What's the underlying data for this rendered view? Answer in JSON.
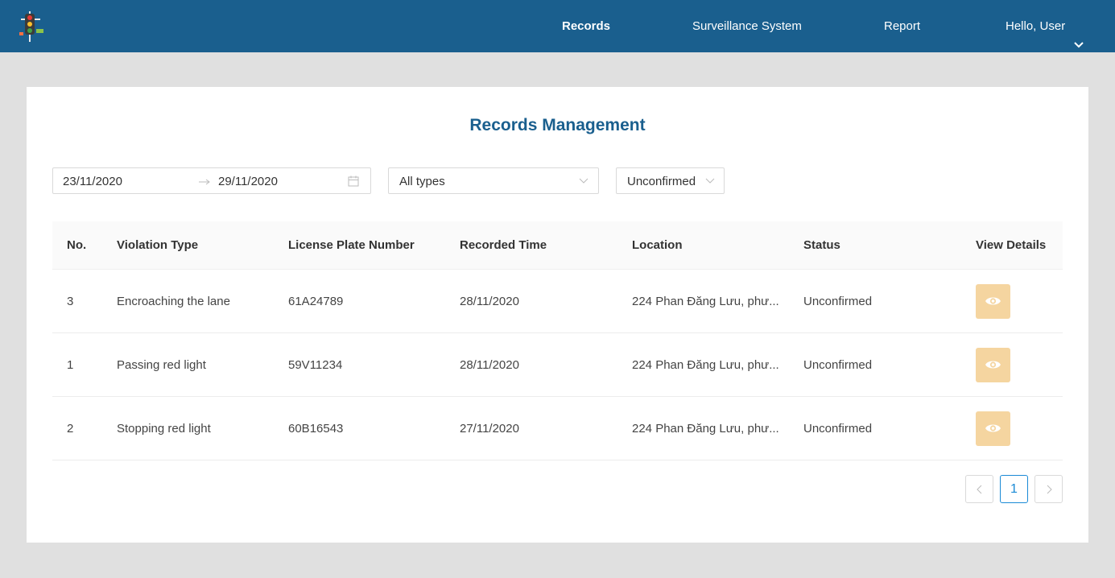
{
  "nav": {
    "items": [
      {
        "label": "Records",
        "active": true
      },
      {
        "label": "Surveillance System",
        "active": false
      },
      {
        "label": "Report",
        "active": false
      }
    ],
    "user_label": "Hello, User",
    "logo_icon": "traffic-light-icon"
  },
  "page": {
    "title": "Records Management"
  },
  "filters": {
    "date_start": "23/11/2020",
    "date_end": "29/11/2020",
    "type_value": "All types",
    "status_value": "Unconfirmed"
  },
  "table": {
    "columns": [
      "No.",
      "Violation Type",
      "License Plate Number",
      "Recorded Time",
      "Location",
      "Status",
      "View Details"
    ],
    "rows": [
      {
        "no": "3",
        "type": "Encroaching the lane",
        "plate": "61A24789",
        "time": "28/11/2020",
        "location": "224 Phan Đăng Lưu, phư...",
        "status": "Unconfirmed"
      },
      {
        "no": "1",
        "type": "Passing red light",
        "plate": "59V11234",
        "time": "28/11/2020",
        "location": "224 Phan Đăng Lưu, phư...",
        "status": "Unconfirmed"
      },
      {
        "no": "2",
        "type": "Stopping red light",
        "plate": "60B16543",
        "time": "27/11/2020",
        "location": "224 Phan Đăng Lưu, phư...",
        "status": "Unconfirmed"
      }
    ]
  },
  "pagination": {
    "current_page": "1"
  },
  "colors": {
    "navbar": "#1a5f8e",
    "title": "#1a5f8e",
    "view_button": "#f5d5a0",
    "page_active": "#1a8ad6"
  }
}
